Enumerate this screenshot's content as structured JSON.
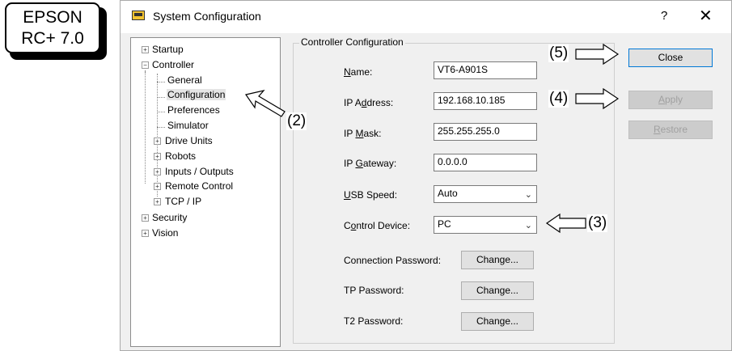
{
  "badge": {
    "line1": "EPSON",
    "line2": "RC+ 7.0"
  },
  "window": {
    "title": "System Configuration",
    "help_label": "?",
    "close_label": "✕"
  },
  "tree": {
    "startup": "Startup",
    "controller": "Controller",
    "general": "General",
    "configuration": "Configuration",
    "preferences": "Preferences",
    "simulator": "Simulator",
    "drive_units": "Drive Units",
    "robots": "Robots",
    "inputs_outputs": "Inputs / Outputs",
    "remote_control": "Remote Control",
    "tcp_ip": "TCP / IP",
    "security": "Security",
    "vision": "Vision"
  },
  "group_title": "Controller Configuration",
  "fields": {
    "name": {
      "label_pre": "",
      "label_u": "N",
      "label_post": "ame:",
      "value": "VT6-A901S"
    },
    "ip_address": {
      "label_pre": "IP A",
      "label_u": "d",
      "label_post": "dress:",
      "value": "192.168.10.185"
    },
    "ip_mask": {
      "label_pre": "IP ",
      "label_u": "M",
      "label_post": "ask:",
      "value": "255.255.255.0"
    },
    "ip_gateway": {
      "label_pre": "IP ",
      "label_u": "G",
      "label_post": "ateway:",
      "value": "0.0.0.0"
    },
    "usb_speed": {
      "label_pre": "",
      "label_u": "U",
      "label_post": "SB Speed:",
      "value": "Auto"
    },
    "control_device": {
      "label_pre": "C",
      "label_u": "o",
      "label_post": "ntrol Device:",
      "value": "PC"
    }
  },
  "passwords": {
    "connection_label": "Connection Password:",
    "tp_label": "TP Password:",
    "t2_label": "T2 Password:",
    "change_label": "Change..."
  },
  "buttons": {
    "close": "Close",
    "apply_u": "A",
    "apply_rest": "pply",
    "restore_u": "R",
    "restore_rest": "estore"
  },
  "annotations": {
    "a2": "(2)",
    "a3": "(3)",
    "a4": "(4)",
    "a5": "(5)"
  }
}
